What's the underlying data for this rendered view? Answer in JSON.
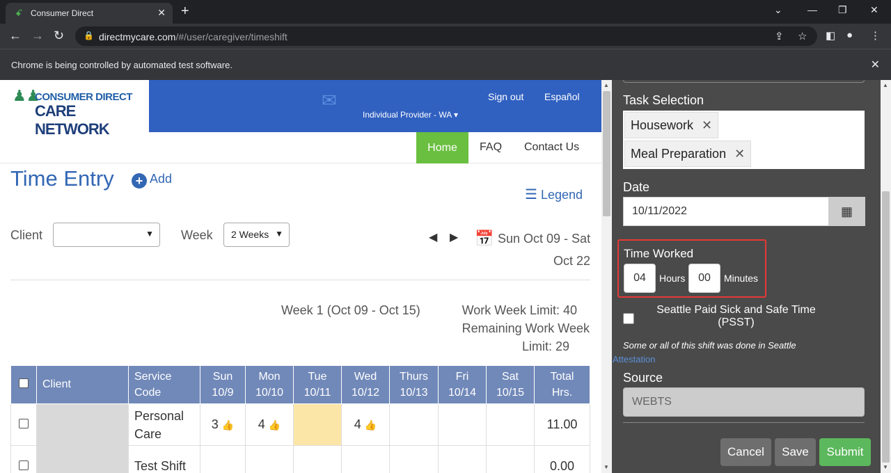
{
  "browser": {
    "tab_title": "Consumer Direct",
    "url_host": "directmycare.com",
    "url_path": "/#/user/caregiver/timeshift",
    "infobar_text": "Chrome is being controlled by automated test software."
  },
  "header": {
    "logo_top": "CONSUMER DIRECT",
    "logo_bottom": "CARE NETWORK",
    "sign_out": "Sign out",
    "language": "Español",
    "provider": "Individual Provider - WA ▾"
  },
  "nav": {
    "home": "Home",
    "faq": "FAQ",
    "contact": "Contact Us"
  },
  "main": {
    "title": "Time Entry",
    "add_label": "Add",
    "legend_label": "Legend",
    "client_label": "Client",
    "client_value": "",
    "week_label": "Week",
    "week_value": "2 Weeks",
    "date_range_line1": "Sun Oct 09 - Sat",
    "date_range_line2": "Oct 22",
    "week1_label": "Week 1 (Oct 09 - Oct 15)",
    "limit_line1": "Work Week Limit: 40",
    "limit_line2": "Remaining Work Week",
    "limit_line3": "Limit: 29"
  },
  "table": {
    "headers": {
      "client": "Client",
      "service_code_1": "Service",
      "service_code_2": "Code",
      "sun_1": "Sun",
      "sun_2": "10/9",
      "mon_1": "Mon",
      "mon_2": "10/10",
      "tue_1": "Tue",
      "tue_2": "10/11",
      "wed_1": "Wed",
      "wed_2": "10/12",
      "thu_1": "Thurs",
      "thu_2": "10/13",
      "fri_1": "Fri",
      "fri_2": "10/14",
      "sat_1": "Sat",
      "sat_2": "10/15",
      "total_1": "Total",
      "total_2": "Hrs."
    },
    "rows": [
      {
        "service_1": "Personal",
        "service_2": "Care",
        "sun": "3",
        "mon": "4",
        "tue": "",
        "wed": "4",
        "thu": "",
        "fri": "",
        "sat": "",
        "total": "11.00"
      },
      {
        "service_1": "Test Shift",
        "service_2": "",
        "sun": "",
        "mon": "",
        "tue": "",
        "wed": "",
        "thu": "",
        "fri": "",
        "sat": "",
        "total": "0.00"
      }
    ]
  },
  "panel": {
    "task_label": "Task Selection",
    "tasks": [
      "Housework",
      "Meal Preparation"
    ],
    "date_label": "Date",
    "date_value": "10/11/2022",
    "time_label": "Time Worked",
    "hours_value": "04",
    "hours_label": "Hours",
    "minutes_value": "00",
    "minutes_label": "Minutes",
    "psst_label": "Seattle Paid Sick and Safe Time (PSST)",
    "seattle_note": "Some or all of this shift was done in Seattle",
    "attestation": "Attestation",
    "source_label": "Source",
    "source_value": "WEBTS",
    "cancel": "Cancel",
    "save": "Save",
    "submit": "Submit"
  },
  "colors": {
    "brand_blue": "#3060c0",
    "home_green": "#6abf40",
    "table_header": "#7189b9",
    "panel_bg": "#4a4a4a",
    "highlight_red": "#e53935"
  }
}
